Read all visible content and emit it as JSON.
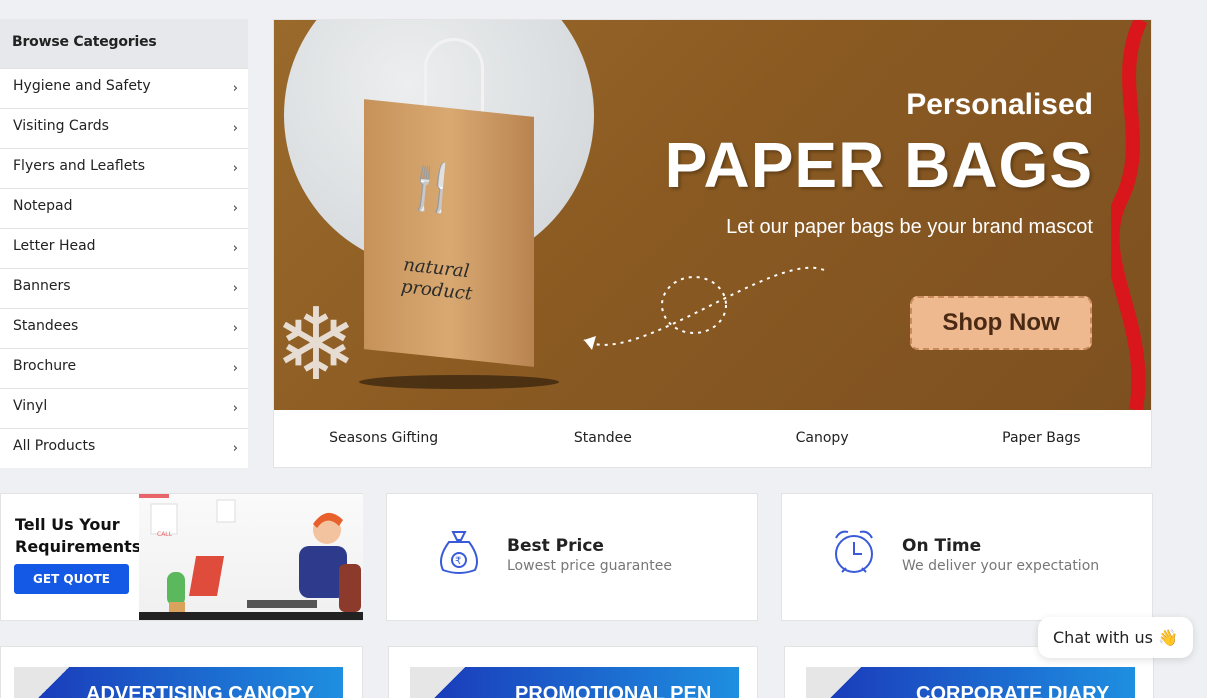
{
  "sidebar": {
    "heading": "Browse Categories",
    "items": [
      {
        "label": "Hygiene and Safety"
      },
      {
        "label": "Visiting Cards"
      },
      {
        "label": "Flyers and Leaflets"
      },
      {
        "label": "Notepad"
      },
      {
        "label": "Letter Head"
      },
      {
        "label": "Banners"
      },
      {
        "label": "Standees"
      },
      {
        "label": "Brochure"
      },
      {
        "label": "Vinyl"
      },
      {
        "label": "All Products"
      }
    ],
    "chevron": "›"
  },
  "banner": {
    "pre_title": "Personalised",
    "title": "PAPER BAGS",
    "subtitle": "Let our paper bags be your brand mascot",
    "cta": "Shop Now",
    "bag_text_line1": "natural",
    "bag_text_line2": "product"
  },
  "tabs": [
    "Seasons Gifting",
    "Standee",
    "Canopy",
    "Paper Bags"
  ],
  "quote": {
    "title_line1": "Tell Us Your",
    "title_line2": "Requirements",
    "button": "GET QUOTE",
    "art_label": "CALL"
  },
  "features": [
    {
      "title": "Best Price",
      "subtitle": "Lowest price guarantee",
      "icon": "money-bag-icon"
    },
    {
      "title": "On Time",
      "subtitle": "We deliver your expectation",
      "icon": "alarm-clock-icon"
    }
  ],
  "bottom_cards": [
    {
      "label": "ADVERTISING CANOPY"
    },
    {
      "label": "PROMOTIONAL PEN"
    },
    {
      "label": "CORPORATE DIARY"
    }
  ],
  "chat": {
    "label": "Chat with us",
    "emoji": "👋"
  },
  "colors": {
    "accent": "#1458e6",
    "banner_brown": "#8a5a22",
    "icon_blue": "#3a5bd9"
  }
}
